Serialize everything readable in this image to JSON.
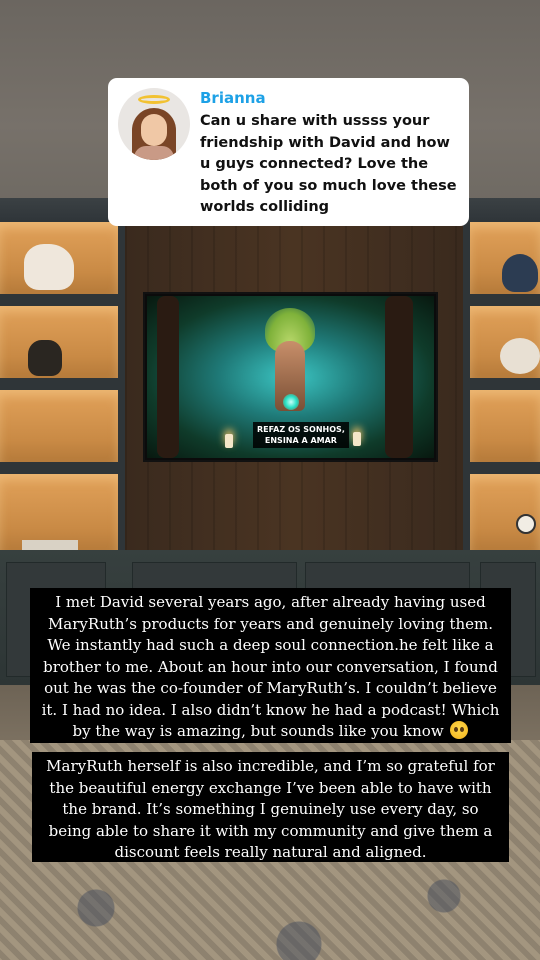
{
  "question": {
    "name": "Brianna",
    "text": "Can u share with ussss your friendship with David and how u guys connected? Love the both of you so much love these worlds colliding"
  },
  "tv": {
    "subtitle_line1": "REFAZ OS SONHOS,",
    "subtitle_line2": "ENSINA A AMAR"
  },
  "captions": [
    {
      "text": "I met David several years ago, after already having used MaryRuth’s products for years and genuinely loving them. We instantly had such a deep soul connection.he felt like a brother to me.  About an hour into our conversation, I found out he was the co-founder of MaryRuth’s. I couldn’t believe it. I had no idea. I also didn’t know he had a podcast! Which by the way is amazing, but sounds like you know",
      "emoji": "pleading-face-icon"
    },
    {
      "text": "MaryRuth herself is also incredible, and I’m so grateful for the beautiful energy exchange I’ve been able to have with the brand. It’s something I genuinely use every day, so being able to share it with my community and give them a discount feels really natural and aligned."
    }
  ],
  "colors": {
    "name_accent": "#1da1e6",
    "card_bg": "#ffffff",
    "caption_bg": "#000000"
  }
}
